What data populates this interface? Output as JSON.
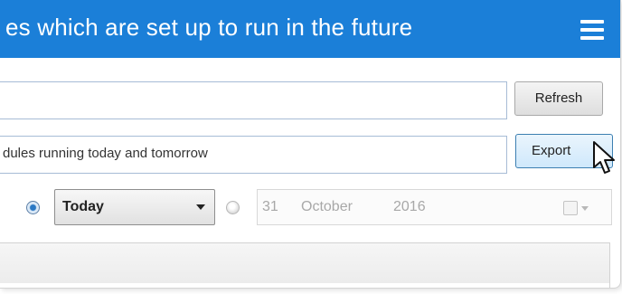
{
  "window": {
    "title": "es which are set up to run in the future",
    "menu_icon": "hamburger-menu-icon",
    "titlebar_color": "#1b7fd8"
  },
  "search": {
    "value": ""
  },
  "description": {
    "value": "dules running today and tomorrow"
  },
  "buttons": {
    "refresh_label": "Refresh",
    "export_label": "Export"
  },
  "filter": {
    "today_selected": true,
    "day_select_value": "Today",
    "date_day": "31",
    "date_month": "October",
    "date_year": "2016"
  },
  "icons": {
    "cursor": "mouse-pointer-icon",
    "calendar_toggle": "checkbox-icon",
    "dropdown": "chevron-down-icon"
  }
}
